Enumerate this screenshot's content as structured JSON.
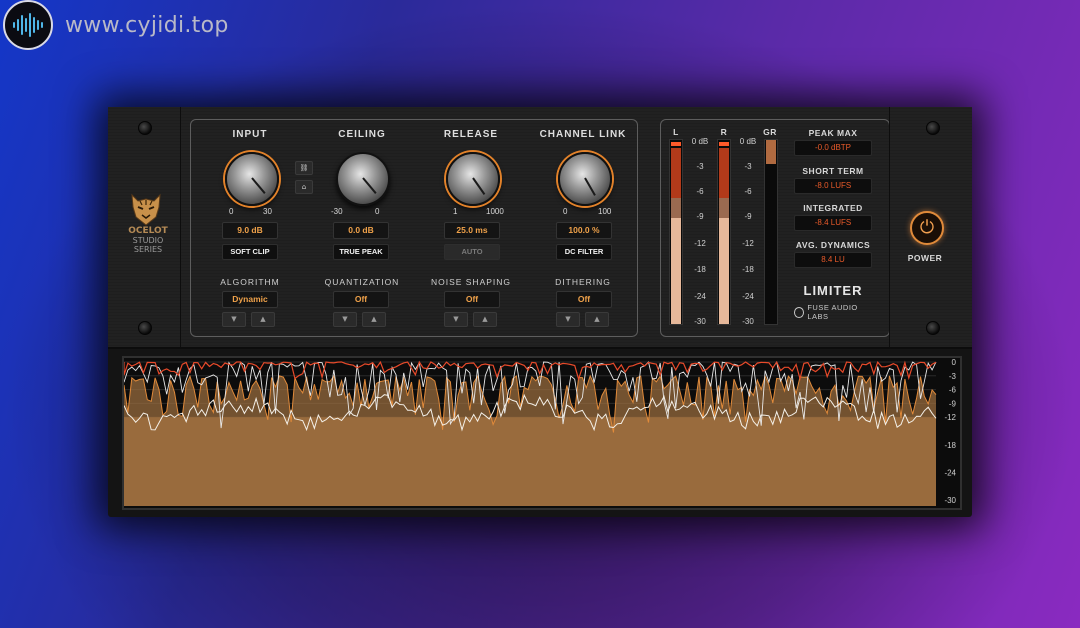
{
  "watermark": {
    "text": "www.cyjidi.top"
  },
  "brand": {
    "line1": "OCELOT",
    "line2": "STUDIO",
    "line3": "SERIES"
  },
  "controls": [
    {
      "label": "INPUT",
      "min": "0",
      "max": "30",
      "value": "9.0 dB",
      "button": "SOFT CLIP",
      "button_active": true
    },
    {
      "label": "CEILING",
      "min": "-30",
      "max": "0",
      "value": "0.0 dB",
      "button": "TRUE PEAK",
      "button_active": true
    },
    {
      "label": "RELEASE",
      "min": "1",
      "max": "1000",
      "value": "25.0 ms",
      "button": "AUTO",
      "button_active": false
    },
    {
      "label": "CHANNEL LINK",
      "min": "0",
      "max": "100",
      "value": "100.0 %",
      "button": "DC FILTER",
      "button_active": true
    }
  ],
  "selectors": [
    {
      "label": "ALGORITHM",
      "value": "Dynamic"
    },
    {
      "label": "QUANTIZATION",
      "value": "Off"
    },
    {
      "label": "NOISE SHAPING",
      "value": "Off"
    },
    {
      "label": "DITHERING",
      "value": "Off"
    }
  ],
  "meters": {
    "l_label": "L",
    "r_label": "R",
    "gr_label": "GR",
    "scale": [
      "0 dB",
      "-3",
      "-6",
      "-9",
      "-12",
      "-18",
      "-24",
      "-30"
    ],
    "gr_scale": [
      "0 dB",
      "-3",
      "-6",
      "-9",
      "-12",
      "-18",
      "-24",
      "-30"
    ]
  },
  "loudness": [
    {
      "label": "PEAK MAX",
      "value": "-0.0 dBTP"
    },
    {
      "label": "SHORT TERM",
      "value": "-8.0 LUFS"
    },
    {
      "label": "INTEGRATED",
      "value": "-8.4 LUFS"
    },
    {
      "label": "AVG. DYNAMICS",
      "value": "8.4 LU"
    }
  ],
  "product": {
    "name": "LIMITER",
    "maker": "FUSE AUDIO LABS"
  },
  "power": {
    "label": "POWER"
  },
  "waveform_scale": [
    "0",
    "-3",
    "-6",
    "-9",
    "-12",
    "-18",
    "-24",
    "-30"
  ],
  "colors": {
    "accent": "#e2822a",
    "value_text": "#f0a24a",
    "meter_red": "#e85a2a",
    "wave_fill": "#a07040"
  }
}
